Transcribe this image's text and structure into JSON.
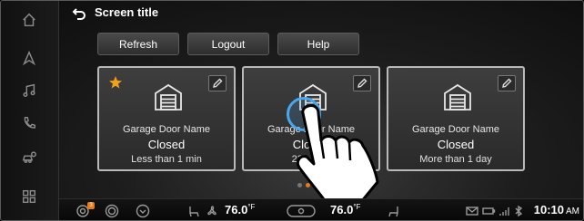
{
  "header": {
    "title": "Screen title",
    "back_icon": "back-arrow-icon"
  },
  "toolbar": {
    "refresh_label": "Refresh",
    "logout_label": "Logout",
    "help_label": "Help"
  },
  "rail": {
    "items": [
      {
        "icon": "home-icon"
      },
      {
        "icon": "navigation-icon"
      },
      {
        "icon": "music-icon"
      },
      {
        "icon": "phone-icon"
      },
      {
        "icon": "car-settings-icon"
      },
      {
        "icon": "apps-grid-icon"
      }
    ]
  },
  "cards": [
    {
      "name": "Garage Door Name",
      "state": "Closed",
      "duration": "Less than 1 min",
      "favorite": true
    },
    {
      "name": "Garage Door Name",
      "state": "Closed",
      "duration": "23h 45m",
      "favorite": false
    },
    {
      "name": "Garage Door Name",
      "state": "Closed",
      "duration": "More than 1 day",
      "favorite": false
    }
  ],
  "pagination": {
    "total": 3,
    "active": 1
  },
  "status_bar": {
    "notification_badge": "3",
    "temp_left": "76.0",
    "temp_right": "76.0",
    "temp_unit": "°F",
    "time": "10:10",
    "ampm": "AM"
  },
  "colors": {
    "accent": "#e87a1a",
    "star": "#f2a018",
    "tap_ring": "#4aa8e8",
    "card_border": "#b9b9b9"
  }
}
